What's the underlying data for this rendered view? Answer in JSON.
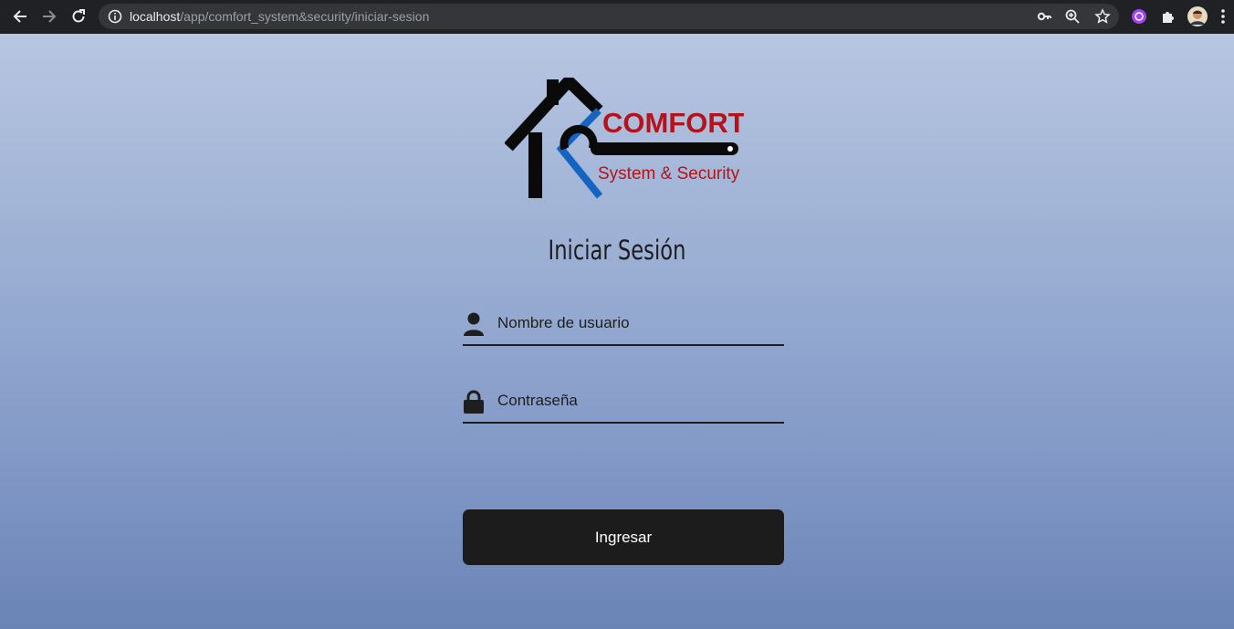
{
  "browser": {
    "url_host": "localhost",
    "url_path": "/app/comfort_system&security/iniciar-sesion"
  },
  "logo": {
    "brand": "COMFORT",
    "tagline": "System & Security",
    "brand_color": "#b5121b",
    "accent_color": "#1565c0"
  },
  "login": {
    "title": "Iniciar Sesión",
    "username_placeholder": "Nombre de usuario",
    "password_placeholder": "Contraseña",
    "submit_label": "Ingresar"
  },
  "icons": [
    "back-icon",
    "forward-icon",
    "reload-icon",
    "info-icon",
    "key-icon",
    "zoom-icon",
    "star-icon",
    "extension-icon",
    "puzzle-icon",
    "avatar",
    "menu-icon",
    "user-icon",
    "lock-icon"
  ],
  "colors": {
    "background_top": "#b7c6e1",
    "background_bottom": "#6a84b6",
    "button": "#1c1c1c"
  }
}
